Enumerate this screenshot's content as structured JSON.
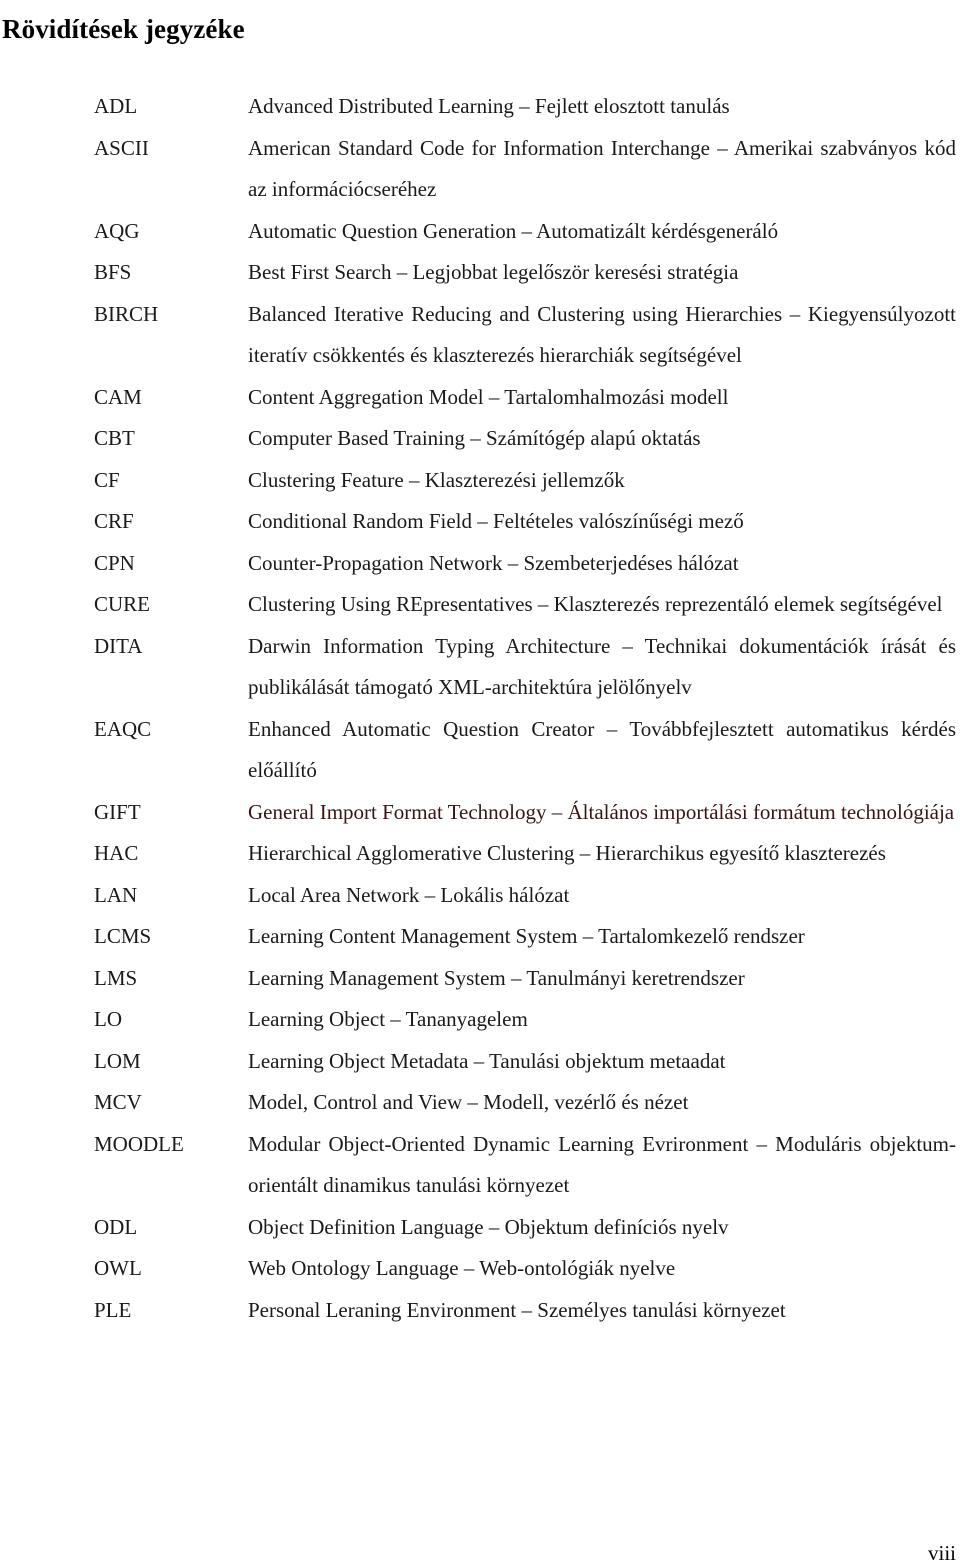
{
  "document": {
    "title": "Rövidítések jegyzéke",
    "page_number": "viii",
    "accent_colors": {
      "text": "#1a1a1a",
      "gift_entry": "#3a1414"
    }
  },
  "entries": [
    {
      "abbr": "ADL",
      "def": "Advanced Distributed Learning – Fejlett elosztott tanulás"
    },
    {
      "abbr": "ASCII",
      "def": "American Standard Code for Information Interchange – Amerikai szabványos kód az információcseréhez"
    },
    {
      "abbr": "AQG",
      "def": "Automatic Question Generation – Automatizált kérdésgeneráló"
    },
    {
      "abbr": "BFS",
      "def": "Best First Search – Legjobbat legelőször keresési stratégia"
    },
    {
      "abbr": "BIRCH",
      "def": "Balanced Iterative Reducing and Clustering using Hierarchies – Kiegyensúlyozott iteratív csökkentés és klaszterezés hierarchiák segítségével"
    },
    {
      "abbr": "CAM",
      "def": "Content Aggregation Model – Tartalomhalmozási modell"
    },
    {
      "abbr": "CBT",
      "def": "Computer Based Training – Számítógép alapú oktatás"
    },
    {
      "abbr": "CF",
      "def": "Clustering Feature – Klaszterezési jellemzők"
    },
    {
      "abbr": "CRF",
      "def": "Conditional Random Field – Feltételes valószínűségi mező"
    },
    {
      "abbr": "CPN",
      "def": "Counter-Propagation Network – Szembeterjedéses hálózat"
    },
    {
      "abbr": "CURE",
      "def": "Clustering Using REpresentatives – Klaszterezés reprezentáló elemek segítségével"
    },
    {
      "abbr": "DITA",
      "def": "Darwin Information Typing Architecture – Technikai dokumentációk írását és publikálását támogató XML-architektúra jelölőnyelv"
    },
    {
      "abbr": "EAQC",
      "def": "Enhanced Automatic Question Creator – Továbbfejlesztett automatikus kérdés előállító"
    },
    {
      "abbr": "GIFT",
      "def": "General Import Format Technology – Általános importálási formátum technológiája"
    },
    {
      "abbr": "HAC",
      "def": "Hierarchical Agglomerative Clustering – Hierarchikus egyesítő klaszterezés"
    },
    {
      "abbr": "LAN",
      "def": "Local Area Network – Lokális hálózat"
    },
    {
      "abbr": "LCMS",
      "def": "Learning Content Management System – Tartalomkezelő rendszer"
    },
    {
      "abbr": "LMS",
      "def": "Learning Management System – Tanulmányi keretrendszer"
    },
    {
      "abbr": "LO",
      "def": "Learning Object – Tananyagelem"
    },
    {
      "abbr": "LOM",
      "def": "Learning Object Metadata – Tanulási objektum metaadat"
    },
    {
      "abbr": "MCV",
      "def": "Model, Control and View – Modell, vezérlő és nézet"
    },
    {
      "abbr": "MOODLE",
      "def": "Modular Object-Oriented Dynamic Learning Evrironment – Moduláris objektum-orientált dinamikus tanulási környezet"
    },
    {
      "abbr": "ODL",
      "def": "Object Definition Language – Objektum definíciós nyelv"
    },
    {
      "abbr": "OWL",
      "def": "Web Ontology Language – Web-ontológiák nyelve"
    },
    {
      "abbr": "PLE",
      "def": "Personal Leraning Environment – Személyes tanulási környezet"
    }
  ]
}
